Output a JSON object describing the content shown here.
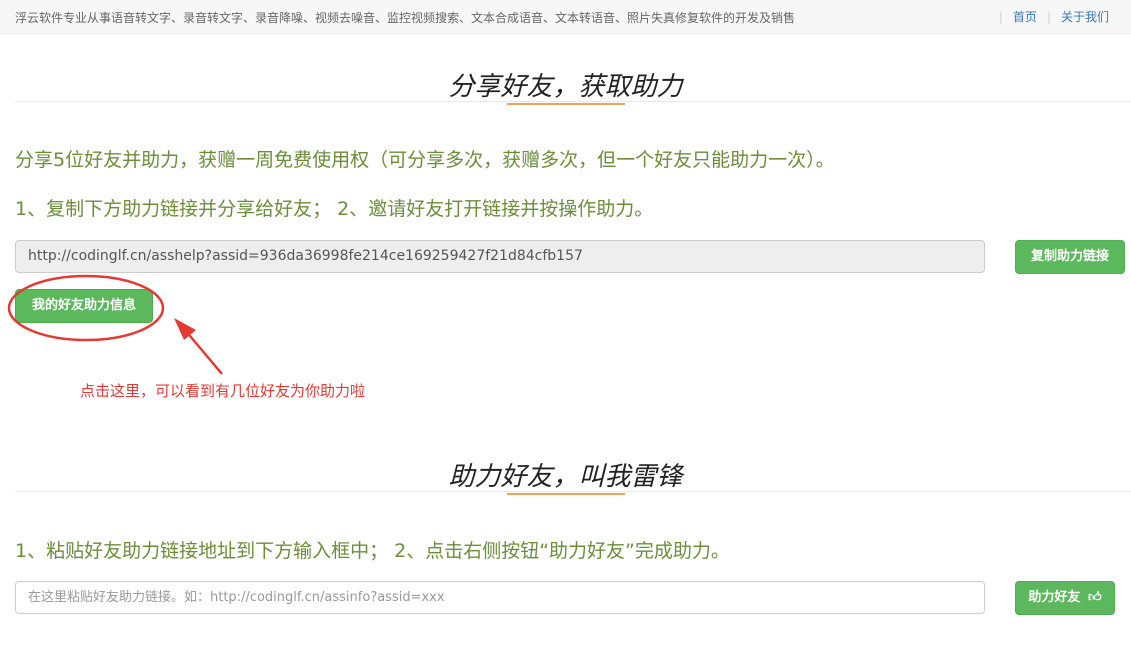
{
  "topbar": {
    "slogan": "浮云软件专业从事语音转文字、录音转文字、录音降噪、视频去噪音、监控视频搜索、文本合成语音、文本转语音、照片失真修复软件的开发及销售",
    "home": "首页",
    "about": "关于我们"
  },
  "share": {
    "title": "分享好友，获取助力",
    "desc": "分享5位好友并助力，获赠一周免费使用权（可分享多次，获赠多次，但一个好友只能助力一次）。",
    "steps": "1、复制下方助力链接并分享给好友；  2、邀请好友打开链接并按操作助力。",
    "link": "http://codinglf.cn/asshelp?assid=936da36998fe214ce169259427f21d84cfb157",
    "copy_button": "复制助力链接",
    "info_button": "我的好友助力信息"
  },
  "annotation": {
    "text": "点击这里，可以看到有几位好友为你助力啦",
    "color": "#e53935"
  },
  "help": {
    "title": "助力好友，叫我雷锋",
    "steps": "1、粘贴好友助力链接地址到下方输入框中；  2、点击右侧按钮“助力好友”完成助力。",
    "placeholder": "在这里粘贴好友助力链接。如：http://codinglf.cn/assinfo?assid=xxx",
    "button": "助力好友"
  },
  "colors": {
    "accent_green": "#5cb85c",
    "text_green": "#6b8e3a",
    "underline_orange": "#f0a060",
    "link_blue": "#337ab7"
  }
}
